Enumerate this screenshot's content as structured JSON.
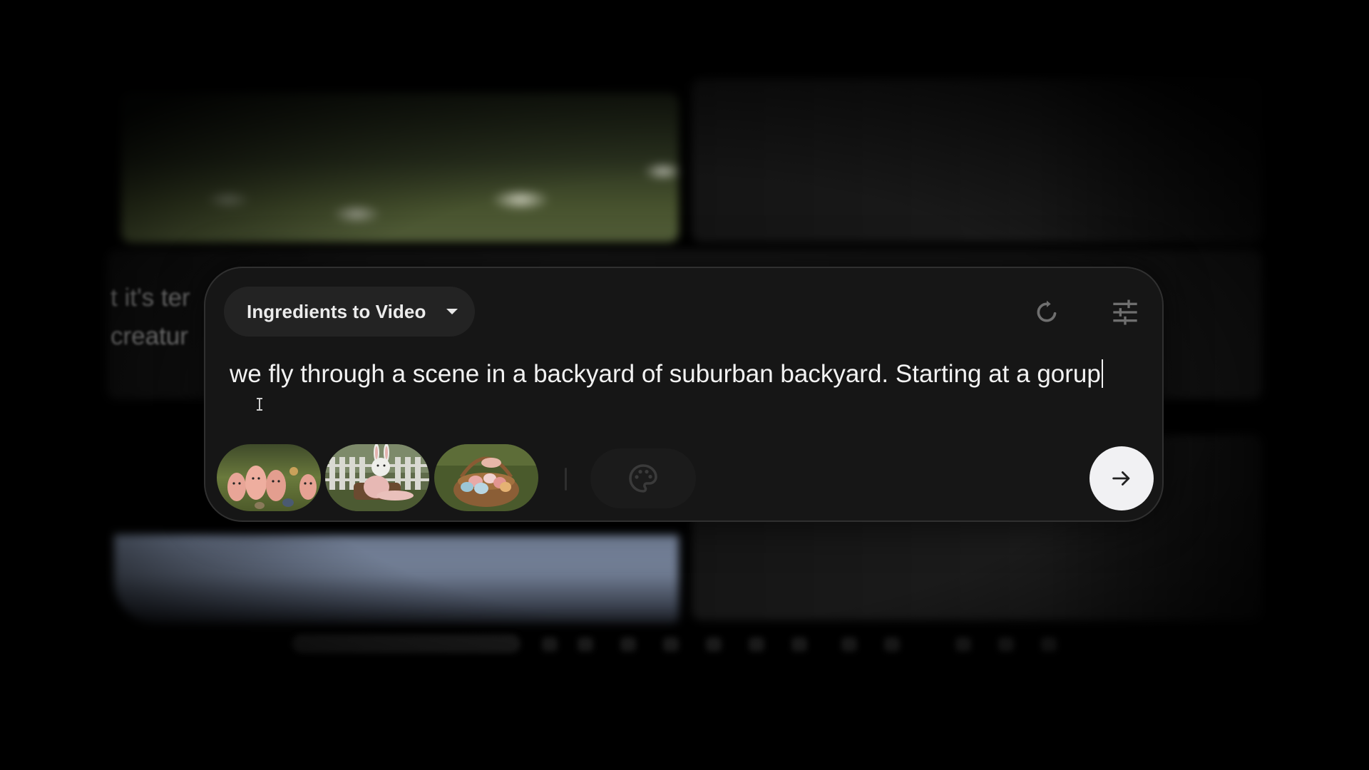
{
  "background": {
    "ghost_lines": [
      "t it's ter",
      "creatur"
    ]
  },
  "composer": {
    "mode_label": "Ingredients to Video",
    "prompt_text": "we fly through a scene in a backyard of suburban backyard. Starting at a gorup",
    "ingredients": [
      {
        "subject": "pink knitted chick figures in a garden"
      },
      {
        "subject": "white rabbit in pink outfit sitting by a fence"
      },
      {
        "subject": "wicker basket of pastel Easter eggs"
      }
    ],
    "icons": {
      "mode_dropdown": "chevron-down-icon",
      "refresh": "refresh-icon",
      "settings": "sliders-icon",
      "style": "palette-icon",
      "send": "arrow-right-icon"
    },
    "colors": {
      "panel": "#161616",
      "panel_border": "#303030",
      "pill": "#232323",
      "send_button": "#f1f1f3",
      "text": "#f2f2f2"
    }
  }
}
